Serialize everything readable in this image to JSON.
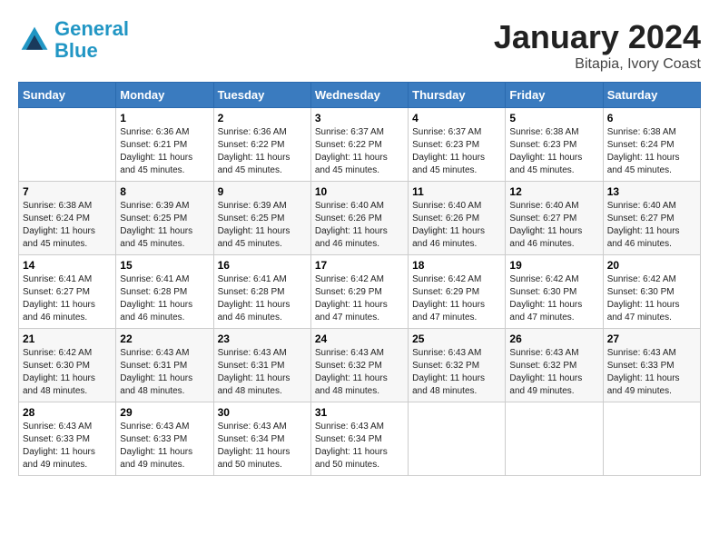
{
  "header": {
    "logo_line1": "General",
    "logo_line2": "Blue",
    "title": "January 2024",
    "location": "Bitapia, Ivory Coast"
  },
  "weekdays": [
    "Sunday",
    "Monday",
    "Tuesday",
    "Wednesday",
    "Thursday",
    "Friday",
    "Saturday"
  ],
  "weeks": [
    [
      {
        "day": "",
        "sunrise": "",
        "sunset": "",
        "daylight": ""
      },
      {
        "day": "1",
        "sunrise": "Sunrise: 6:36 AM",
        "sunset": "Sunset: 6:21 PM",
        "daylight": "Daylight: 11 hours and 45 minutes."
      },
      {
        "day": "2",
        "sunrise": "Sunrise: 6:36 AM",
        "sunset": "Sunset: 6:22 PM",
        "daylight": "Daylight: 11 hours and 45 minutes."
      },
      {
        "day": "3",
        "sunrise": "Sunrise: 6:37 AM",
        "sunset": "Sunset: 6:22 PM",
        "daylight": "Daylight: 11 hours and 45 minutes."
      },
      {
        "day": "4",
        "sunrise": "Sunrise: 6:37 AM",
        "sunset": "Sunset: 6:23 PM",
        "daylight": "Daylight: 11 hours and 45 minutes."
      },
      {
        "day": "5",
        "sunrise": "Sunrise: 6:38 AM",
        "sunset": "Sunset: 6:23 PM",
        "daylight": "Daylight: 11 hours and 45 minutes."
      },
      {
        "day": "6",
        "sunrise": "Sunrise: 6:38 AM",
        "sunset": "Sunset: 6:24 PM",
        "daylight": "Daylight: 11 hours and 45 minutes."
      }
    ],
    [
      {
        "day": "7",
        "sunrise": "Sunrise: 6:38 AM",
        "sunset": "Sunset: 6:24 PM",
        "daylight": "Daylight: 11 hours and 45 minutes."
      },
      {
        "day": "8",
        "sunrise": "Sunrise: 6:39 AM",
        "sunset": "Sunset: 6:25 PM",
        "daylight": "Daylight: 11 hours and 45 minutes."
      },
      {
        "day": "9",
        "sunrise": "Sunrise: 6:39 AM",
        "sunset": "Sunset: 6:25 PM",
        "daylight": "Daylight: 11 hours and 45 minutes."
      },
      {
        "day": "10",
        "sunrise": "Sunrise: 6:40 AM",
        "sunset": "Sunset: 6:26 PM",
        "daylight": "Daylight: 11 hours and 46 minutes."
      },
      {
        "day": "11",
        "sunrise": "Sunrise: 6:40 AM",
        "sunset": "Sunset: 6:26 PM",
        "daylight": "Daylight: 11 hours and 46 minutes."
      },
      {
        "day": "12",
        "sunrise": "Sunrise: 6:40 AM",
        "sunset": "Sunset: 6:27 PM",
        "daylight": "Daylight: 11 hours and 46 minutes."
      },
      {
        "day": "13",
        "sunrise": "Sunrise: 6:40 AM",
        "sunset": "Sunset: 6:27 PM",
        "daylight": "Daylight: 11 hours and 46 minutes."
      }
    ],
    [
      {
        "day": "14",
        "sunrise": "Sunrise: 6:41 AM",
        "sunset": "Sunset: 6:27 PM",
        "daylight": "Daylight: 11 hours and 46 minutes."
      },
      {
        "day": "15",
        "sunrise": "Sunrise: 6:41 AM",
        "sunset": "Sunset: 6:28 PM",
        "daylight": "Daylight: 11 hours and 46 minutes."
      },
      {
        "day": "16",
        "sunrise": "Sunrise: 6:41 AM",
        "sunset": "Sunset: 6:28 PM",
        "daylight": "Daylight: 11 hours and 46 minutes."
      },
      {
        "day": "17",
        "sunrise": "Sunrise: 6:42 AM",
        "sunset": "Sunset: 6:29 PM",
        "daylight": "Daylight: 11 hours and 47 minutes."
      },
      {
        "day": "18",
        "sunrise": "Sunrise: 6:42 AM",
        "sunset": "Sunset: 6:29 PM",
        "daylight": "Daylight: 11 hours and 47 minutes."
      },
      {
        "day": "19",
        "sunrise": "Sunrise: 6:42 AM",
        "sunset": "Sunset: 6:30 PM",
        "daylight": "Daylight: 11 hours and 47 minutes."
      },
      {
        "day": "20",
        "sunrise": "Sunrise: 6:42 AM",
        "sunset": "Sunset: 6:30 PM",
        "daylight": "Daylight: 11 hours and 47 minutes."
      }
    ],
    [
      {
        "day": "21",
        "sunrise": "Sunrise: 6:42 AM",
        "sunset": "Sunset: 6:30 PM",
        "daylight": "Daylight: 11 hours and 48 minutes."
      },
      {
        "day": "22",
        "sunrise": "Sunrise: 6:43 AM",
        "sunset": "Sunset: 6:31 PM",
        "daylight": "Daylight: 11 hours and 48 minutes."
      },
      {
        "day": "23",
        "sunrise": "Sunrise: 6:43 AM",
        "sunset": "Sunset: 6:31 PM",
        "daylight": "Daylight: 11 hours and 48 minutes."
      },
      {
        "day": "24",
        "sunrise": "Sunrise: 6:43 AM",
        "sunset": "Sunset: 6:32 PM",
        "daylight": "Daylight: 11 hours and 48 minutes."
      },
      {
        "day": "25",
        "sunrise": "Sunrise: 6:43 AM",
        "sunset": "Sunset: 6:32 PM",
        "daylight": "Daylight: 11 hours and 48 minutes."
      },
      {
        "day": "26",
        "sunrise": "Sunrise: 6:43 AM",
        "sunset": "Sunset: 6:32 PM",
        "daylight": "Daylight: 11 hours and 49 minutes."
      },
      {
        "day": "27",
        "sunrise": "Sunrise: 6:43 AM",
        "sunset": "Sunset: 6:33 PM",
        "daylight": "Daylight: 11 hours and 49 minutes."
      }
    ],
    [
      {
        "day": "28",
        "sunrise": "Sunrise: 6:43 AM",
        "sunset": "Sunset: 6:33 PM",
        "daylight": "Daylight: 11 hours and 49 minutes."
      },
      {
        "day": "29",
        "sunrise": "Sunrise: 6:43 AM",
        "sunset": "Sunset: 6:33 PM",
        "daylight": "Daylight: 11 hours and 49 minutes."
      },
      {
        "day": "30",
        "sunrise": "Sunrise: 6:43 AM",
        "sunset": "Sunset: 6:34 PM",
        "daylight": "Daylight: 11 hours and 50 minutes."
      },
      {
        "day": "31",
        "sunrise": "Sunrise: 6:43 AM",
        "sunset": "Sunset: 6:34 PM",
        "daylight": "Daylight: 11 hours and 50 minutes."
      },
      {
        "day": "",
        "sunrise": "",
        "sunset": "",
        "daylight": ""
      },
      {
        "day": "",
        "sunrise": "",
        "sunset": "",
        "daylight": ""
      },
      {
        "day": "",
        "sunrise": "",
        "sunset": "",
        "daylight": ""
      }
    ]
  ]
}
